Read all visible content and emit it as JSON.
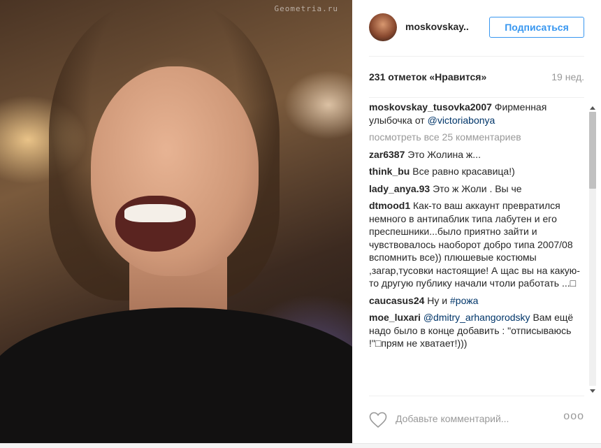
{
  "photo": {
    "watermark": "Geometria.ru"
  },
  "header": {
    "username": "moskovskay..",
    "follow_label": "Подписаться"
  },
  "likes": {
    "text": "231 отметок «Нравится»",
    "age": "19 нед."
  },
  "caption": {
    "user": "moskovskay_tusovka2007",
    "text": "Фирменная улыбочка от",
    "mention": "@victoriabonya"
  },
  "view_all": "посмотреть все 25 комментариев",
  "comments": [
    {
      "user": "zar6387",
      "text": "Это Жолина ж..."
    },
    {
      "user": "think_bu",
      "text": "Все равно красавица!)"
    },
    {
      "user": "lady_anya.93",
      "text": "Это ж Жоли . Вы че"
    },
    {
      "user": "dtmood1",
      "text": "Как-то ваш аккаунт превратился немного в антипаблик типа лабутен и его преспешники...было приятно зайти и чувствовалось наоборот добро типа 2007/08 вспомнить все)) плюшевые костюмы ,загар,тусовки настоящие! А щас вы на какую-то другую публику начали чтоли работать ...□"
    },
    {
      "user": "caucasus24",
      "text": "Ну и",
      "tag": "#рожа"
    },
    {
      "user": "moe_luxari",
      "mention": "@dmitry_arhangorodsky",
      "text": "Вам ещё надо было в конце добавить : \"отписываюсь !\"□прям не хватает!)))"
    }
  ],
  "add_comment": {
    "placeholder": "Добавьте комментарий...",
    "more": "ооо"
  },
  "icons": {
    "like": "heart-outline-icon",
    "more": "more-dots-icon",
    "scroll_up": "arrow-up-icon",
    "scroll_down": "arrow-down-icon"
  },
  "colors": {
    "accent": "#3897f0",
    "mention": "#003569",
    "muted": "#999999"
  }
}
